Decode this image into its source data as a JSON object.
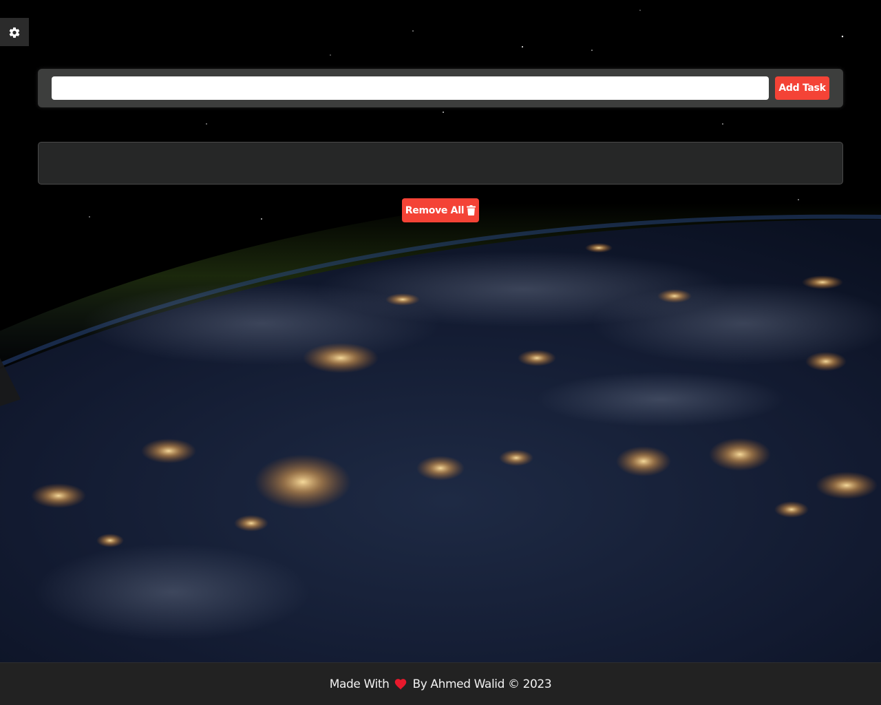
{
  "settings": {
    "icon": "gear-icon"
  },
  "form": {
    "input_value": "",
    "input_placeholder": "",
    "add_label": "Add Task"
  },
  "tasks": [],
  "remove_all": {
    "label": "Remove All",
    "icon": "trash-icon"
  },
  "footer": {
    "made_with": "Made With",
    "by_text": "By Ahmed Walid © 2023",
    "heart_icon": "heart-icon"
  },
  "colors": {
    "accent": "#f44336",
    "form_bg": "#3d3e3d",
    "tasks_bg": "#262727",
    "footer_bg": "#222222"
  }
}
